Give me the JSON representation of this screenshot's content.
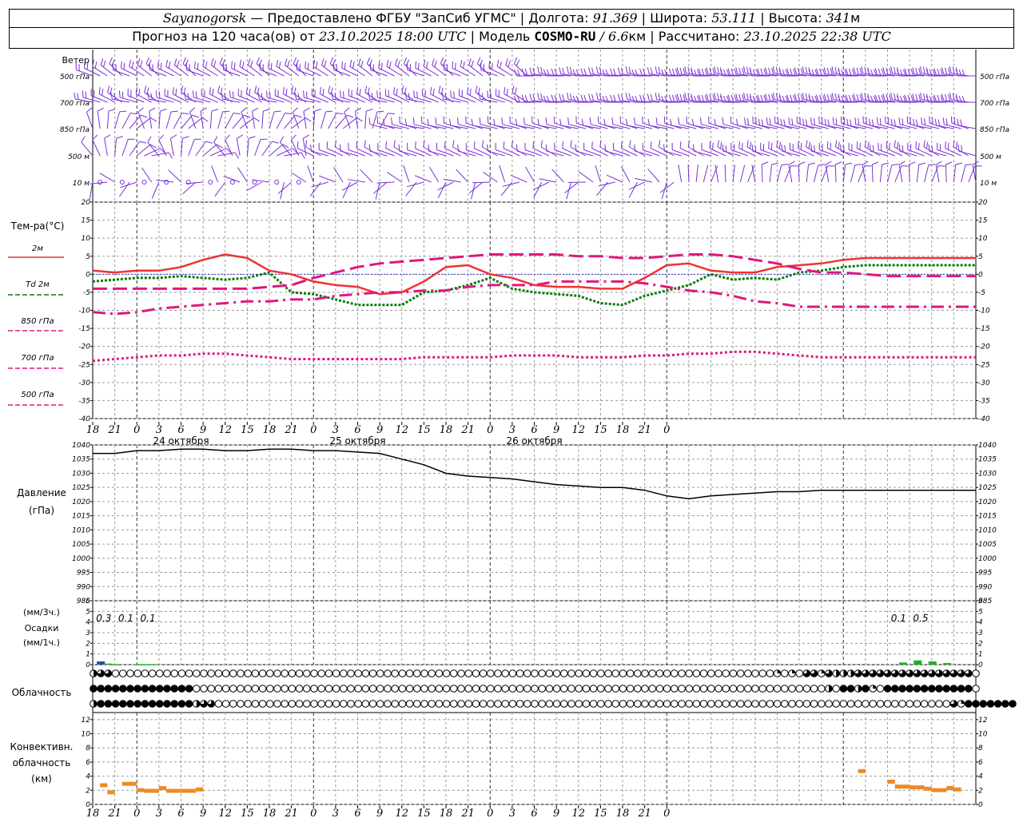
{
  "header": {
    "station": "Sayanogorsk",
    "provider": "— Предоставлено ФГБУ \"ЗапСиб УГМС\"",
    "lon_label": "| Долгота:",
    "lon_value": "91.369",
    "lat_label": "| Широта:",
    "lat_value": "53.111",
    "alt_label": "| Высота:",
    "alt_value": "341",
    "alt_unit": "м",
    "forecast_label": "Прогноз на 120 часа(ов) от",
    "forecast_start": "23.10.2025 18:00 UTC",
    "model_label": "| Модель",
    "model_name": "COSMO-RU",
    "model_res": "/ 6.6",
    "model_res_unit": "км",
    "calc_label": "| Рассчитано:",
    "calc_time": "23.10.2025 22:38 UTC"
  },
  "colors": {
    "wind": "#7b2fd4",
    "t2m": "#ee3333",
    "td2m": "#0a7a0a",
    "t850": "#e0177e",
    "t700": "#e0177e",
    "t500": "#e0177e",
    "zero_line": "#3a3ad4",
    "pressure": "#000000",
    "precip_blue": "#1f4fb0",
    "precip_green": "#22b022",
    "conv": "#ef8a22",
    "grid": "#9a9a9a"
  },
  "chart_data": [
    {
      "type": "wind_barbs",
      "panel_label": "Ветер",
      "levels": [
        "500 гПа",
        "700 гПа",
        "850 гПа",
        "500 м",
        "10 м"
      ]
    },
    {
      "type": "line",
      "panel_label": "Тем-ра(°C)",
      "ylim": [
        -40,
        20
      ],
      "yticks": [
        20,
        15,
        10,
        5,
        0,
        -5,
        -10,
        -15,
        -20,
        -25,
        -30,
        -35,
        -40
      ],
      "legend": [
        "2м",
        "Td 2м",
        "850 гПа",
        "700 гПа",
        "500 гПа"
      ],
      "x": [
        0,
        3,
        6,
        9,
        12,
        15,
        18,
        21,
        24,
        27,
        30,
        33,
        36,
        39,
        42,
        45,
        48,
        51,
        54,
        57,
        60,
        63,
        66,
        69,
        72,
        75,
        78,
        81,
        84,
        87,
        90,
        93,
        96,
        99,
        102,
        105,
        108,
        111,
        114,
        117,
        120
      ],
      "series": [
        {
          "name": "2м",
          "values": [
            1,
            0.5,
            1,
            1,
            2,
            4,
            5.5,
            4.5,
            1,
            0,
            -2,
            -3,
            -3.5,
            -5.5,
            -5,
            -2,
            2,
            2.5,
            0,
            -1,
            -3,
            -3.5,
            -3.5,
            -4,
            -4,
            -1,
            2.5,
            3,
            1,
            0.5,
            0.5,
            2,
            2.5,
            3,
            4,
            4.5,
            4.5,
            4.5,
            4.5,
            4.5,
            4.5
          ]
        },
        {
          "name": "Td 2м",
          "values": [
            -2,
            -1.5,
            -1,
            -1,
            -0.5,
            -1,
            -1.5,
            -1,
            0.5,
            -5,
            -5.5,
            -7,
            -8.5,
            -8.5,
            -8.5,
            -5,
            -4.5,
            -3,
            -1,
            -4,
            -5,
            -5.5,
            -6,
            -8,
            -8.5,
            -6,
            -4.5,
            -3,
            0,
            -1.5,
            -1,
            -1.5,
            0.5,
            1,
            2,
            2.5,
            2.5,
            2.5,
            2.5,
            2.5,
            2.5
          ]
        },
        {
          "name": "850 гПа",
          "values": [
            -4,
            -4,
            -4,
            -4,
            -4,
            -4,
            -4,
            -4,
            -3.5,
            -3,
            -1,
            0.5,
            2,
            3,
            3.5,
            4,
            4.5,
            5,
            5.5,
            5.5,
            5.5,
            5.5,
            5,
            5,
            4.5,
            4.5,
            5,
            5.5,
            5.5,
            5,
            4,
            3,
            1.5,
            0.5,
            0.5,
            0,
            -0.5,
            -0.5,
            -0.5,
            -0.5,
            -0.5
          ]
        },
        {
          "name": "700 гПа",
          "values": [
            -10.5,
            -11,
            -10.5,
            -9.5,
            -9,
            -8.5,
            -8,
            -7.5,
            -7.5,
            -7,
            -7,
            -6,
            -5.5,
            -5,
            -5,
            -4.5,
            -4.5,
            -3.5,
            -3,
            -3,
            -3,
            -2,
            -2,
            -2,
            -2,
            -2.5,
            -3.5,
            -4.5,
            -5,
            -6,
            -7.5,
            -8,
            -9,
            -9,
            -9,
            -9,
            -9,
            -9,
            -9,
            -9,
            -9
          ]
        },
        {
          "name": "500 гПа",
          "values": [
            -24,
            -23.5,
            -23,
            -22.5,
            -22.5,
            -22,
            -22,
            -22.5,
            -23,
            -23.5,
            -23.5,
            -23.5,
            -23.5,
            -23.5,
            -23.5,
            -23,
            -23,
            -23,
            -23,
            -22.5,
            -22.5,
            -22.5,
            -23,
            -23,
            -23,
            -22.5,
            -22.5,
            -22,
            -22,
            -21.5,
            -21.5,
            -22,
            -22.5,
            -23,
            -23,
            -23,
            -23,
            -23,
            -23,
            -23,
            -23
          ]
        }
      ]
    },
    {
      "type": "line",
      "panel_label": "Давление",
      "unit_label": "(гПа)",
      "ylim": [
        985,
        1040
      ],
      "yticks": [
        1040,
        1035,
        1030,
        1025,
        1020,
        1015,
        1010,
        1005,
        1000,
        995,
        990,
        985
      ],
      "x": [
        0,
        3,
        6,
        9,
        12,
        15,
        18,
        21,
        24,
        27,
        30,
        33,
        36,
        39,
        42,
        45,
        48,
        51,
        54,
        57,
        60,
        63,
        66,
        69,
        72,
        75,
        78,
        81,
        84,
        87,
        90,
        93,
        96,
        99,
        102,
        105,
        108,
        111,
        114,
        117,
        120
      ],
      "series": [
        {
          "name": "",
          "values": [
            1037,
            1037,
            1038,
            1038,
            1038.5,
            1038.5,
            1038,
            1038,
            1038.5,
            1038.5,
            1038,
            1038,
            1037.5,
            1037,
            1035,
            1033,
            1030,
            1029,
            1028.5,
            1028,
            1027,
            1026,
            1025.5,
            1025,
            1025,
            1024,
            1022,
            1021,
            1022,
            1022.5,
            1023,
            1023.5,
            1023.5,
            1024,
            1024,
            1024,
            1024,
            1024,
            1024,
            1024,
            1024
          ]
        }
      ]
    },
    {
      "type": "bar",
      "panel_label": "Осадки",
      "unit_labels": [
        "(мм/3ч.)",
        "(мм/1ч.)"
      ],
      "ylim": [
        0,
        6
      ],
      "yticks": [
        6,
        5,
        4,
        3,
        2,
        1,
        0
      ],
      "sums": [
        {
          "x": 1.5,
          "text": "0.3"
        },
        {
          "x": 4.5,
          "text": "0.1"
        },
        {
          "x": 7.5,
          "text": "0.1"
        },
        {
          "x": 109.5,
          "text": "0.1"
        },
        {
          "x": 112.5,
          "text": "0.5"
        }
      ],
      "bars": [
        {
          "x": 1,
          "value": 0.3,
          "color": "blue"
        },
        {
          "x": 2,
          "value": 0.1,
          "color": "green"
        },
        {
          "x": 3,
          "value": 0.05,
          "color": "green"
        },
        {
          "x": 6,
          "value": 0.05,
          "color": "green"
        },
        {
          "x": 7,
          "value": 0.05,
          "color": "green"
        },
        {
          "x": 8,
          "value": 0.05,
          "color": "green"
        },
        {
          "x": 110,
          "value": 0.2,
          "color": "green"
        },
        {
          "x": 112,
          "value": 0.4,
          "color": "green"
        },
        {
          "x": 114,
          "value": 0.3,
          "color": "green"
        },
        {
          "x": 116,
          "value": 0.15,
          "color": "green"
        }
      ]
    },
    {
      "type": "heatmap",
      "panel_label": "Облачность",
      "rows": [
        "high",
        "middle",
        "low"
      ],
      "cover_levels": "0 clear, 1 quarter, 2 half, 3 three-quarters, 4 overcast"
    },
    {
      "type": "bar",
      "panel_label": "Конвективн. облачность (км)",
      "ylim": [
        0,
        13
      ],
      "yticks": [
        12,
        10,
        8,
        6,
        4,
        2,
        0
      ],
      "segments": [
        {
          "x0": 1,
          "x1": 2,
          "top": 3
        },
        {
          "x0": 2,
          "x1": 3,
          "top": 2
        },
        {
          "x0": 4,
          "x1": 6,
          "top": 3.2
        },
        {
          "x0": 6,
          "x1": 7,
          "top": 2.3
        },
        {
          "x0": 7,
          "x1": 9,
          "top": 2.2
        },
        {
          "x0": 9,
          "x1": 10,
          "top": 2.6
        },
        {
          "x0": 10,
          "x1": 14,
          "top": 2.2
        },
        {
          "x0": 14,
          "x1": 15,
          "top": 2.4
        },
        {
          "x0": 104,
          "x1": 105,
          "top": 5
        },
        {
          "x0": 108,
          "x1": 109,
          "top": 3.5
        },
        {
          "x0": 109,
          "x1": 111,
          "top": 2.8
        },
        {
          "x0": 111,
          "x1": 113,
          "top": 2.7
        },
        {
          "x0": 113,
          "x1": 114,
          "top": 2.5
        },
        {
          "x0": 114,
          "x1": 116,
          "top": 2.3
        },
        {
          "x0": 116,
          "x1": 117,
          "top": 2.6
        },
        {
          "x0": 117,
          "x1": 118,
          "top": 2.4
        }
      ]
    }
  ],
  "x_axis": {
    "tick_labels": [
      "18",
      "21",
      "0",
      "3",
      "6",
      "9",
      "12",
      "15",
      "18",
      "21",
      "0",
      "3",
      "6",
      "9",
      "12",
      "15",
      "18",
      "21",
      "0",
      "3",
      "6",
      "9",
      "12",
      "15",
      "18",
      "21",
      "0"
    ],
    "day_labels": [
      "24 октября",
      "25 октября",
      "26 октября"
    ]
  },
  "cloud_rows": {
    "high": [
      2,
      3,
      3,
      0,
      0,
      0,
      0,
      0,
      0,
      0,
      0,
      0,
      0,
      0,
      0,
      0,
      0,
      0,
      0,
      0,
      0,
      0,
      0,
      0,
      0,
      0,
      0,
      0,
      0,
      0,
      0,
      0,
      0,
      0,
      0,
      0,
      0,
      0,
      0,
      0,
      0,
      0,
      0,
      0,
      0,
      0,
      0,
      0,
      0,
      0,
      0,
      0,
      0,
      0,
      0,
      0,
      0,
      0,
      0,
      0,
      0,
      0,
      0,
      0,
      0,
      0,
      0,
      0,
      0,
      0,
      0,
      0,
      0,
      0,
      0,
      0,
      0,
      0,
      0,
      0,
      0,
      0,
      0,
      0,
      0,
      0,
      0,
      0,
      0,
      0,
      0,
      0,
      0,
      1,
      0,
      1,
      0,
      3,
      3,
      1,
      3,
      2,
      2,
      2,
      3,
      3,
      3,
      3,
      3,
      3,
      3,
      3,
      3,
      3,
      3,
      3,
      3,
      3,
      3,
      3,
      0
    ],
    "middle": [
      4,
      4,
      4,
      4,
      4,
      4,
      4,
      4,
      4,
      4,
      4,
      4,
      4,
      4,
      0,
      0,
      0,
      0,
      0,
      0,
      0,
      0,
      0,
      0,
      0,
      0,
      0,
      0,
      0,
      0,
      0,
      0,
      0,
      0,
      0,
      0,
      0,
      0,
      0,
      0,
      0,
      0,
      0,
      0,
      0,
      0,
      0,
      0,
      0,
      0,
      0,
      0,
      0,
      0,
      0,
      0,
      0,
      0,
      0,
      0,
      0,
      0,
      0,
      0,
      0,
      0,
      0,
      0,
      0,
      0,
      0,
      0,
      0,
      0,
      0,
      0,
      0,
      0,
      0,
      0,
      0,
      0,
      0,
      0,
      0,
      0,
      0,
      0,
      0,
      0,
      0,
      0,
      0,
      0,
      0,
      0,
      0,
      0,
      0,
      0,
      2,
      0,
      4,
      4,
      2,
      4,
      1,
      0,
      4,
      4,
      4,
      4,
      4,
      4,
      4,
      4,
      4,
      4,
      4,
      4,
      0
    ],
    "low": [
      2,
      4,
      4,
      4,
      4,
      4,
      4,
      4,
      4,
      4,
      4,
      4,
      4,
      4,
      2,
      3,
      3,
      0,
      0,
      0,
      0,
      0,
      0,
      0,
      0,
      0,
      0,
      0,
      0,
      0,
      0,
      0,
      0,
      0,
      0,
      0,
      0,
      0,
      0,
      0,
      0,
      0,
      0,
      0,
      0,
      0,
      0,
      0,
      0,
      0,
      0,
      0,
      0,
      0,
      0,
      0,
      0,
      0,
      0,
      0,
      0,
      0,
      0,
      0,
      0,
      0,
      0,
      0,
      0,
      0,
      0,
      0,
      0,
      0,
      0,
      0,
      0,
      0,
      0,
      0,
      0,
      0,
      0,
      0,
      0,
      0,
      0,
      0,
      0,
      0,
      0,
      0,
      0,
      0,
      0,
      0,
      0,
      0,
      0,
      0,
      0,
      0,
      0,
      0,
      0,
      0,
      0,
      0,
      0,
      0,
      0,
      0,
      0,
      0,
      0,
      0,
      0,
      3,
      1,
      4,
      4,
      4,
      4,
      4,
      4,
      4
    ]
  }
}
